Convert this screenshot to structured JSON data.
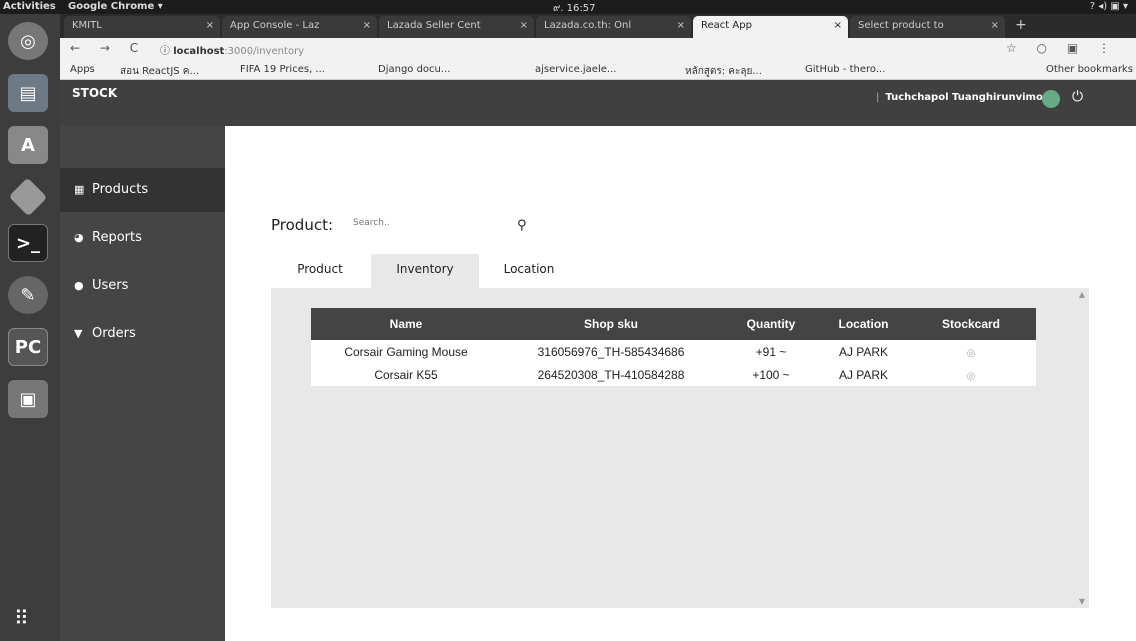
{
  "system": {
    "activities": "Activities",
    "app_name": "Google Chrome ▾",
    "clock": "๙. 16:57",
    "tray": "? ◂) ▣ ▾"
  },
  "browser": {
    "tabs": [
      {
        "label": "KMITL"
      },
      {
        "label": "App Console - Laz"
      },
      {
        "label": "Lazada Seller Cent"
      },
      {
        "label": "Lazada.co.th: Onl"
      },
      {
        "label": "React App"
      },
      {
        "label": "Select product to"
      }
    ],
    "active_tab": 4,
    "url_host": "localhost",
    "url_path": ":3000/inventory",
    "bookmarks": [
      "Apps",
      "สอน ReactJS ค...",
      "FIFA 19 Prices, ...",
      "Django docu...",
      "ajservice.jaele...",
      "หลักสูตร: คะลุย...",
      "GitHub - thero...",
      "Other bookmarks"
    ]
  },
  "app": {
    "brand": "STOCK",
    "user_name": "Tuchchapol Tuanghirunvimon",
    "sidebar": [
      {
        "label": "Products",
        "icon": "boxes-icon"
      },
      {
        "label": "Reports",
        "icon": "pie-chart-icon"
      },
      {
        "label": "Users",
        "icon": "user-icon"
      },
      {
        "label": "Orders",
        "icon": "cart-icon"
      }
    ],
    "active_sidebar": 0,
    "search": {
      "label": "Product:",
      "placeholder": "Search.."
    },
    "tabs": [
      "Product",
      "Inventory",
      "Location"
    ],
    "active_tab": 1,
    "table": {
      "headers": [
        "Name",
        "Shop sku",
        "Quantity",
        "Location",
        "Stockcard"
      ],
      "rows": [
        {
          "name": "Corsair Gaming Mouse",
          "sku": "316056976_TH-585434686",
          "quantity": "+91 ~",
          "location": "AJ PARK"
        },
        {
          "name": "Corsair K55",
          "sku": "264520308_TH-410584288",
          "quantity": "+100 ~",
          "location": "AJ PARK"
        }
      ]
    }
  },
  "colors": {
    "header_bg": "#404040",
    "sidebar_bg": "#454545",
    "sidebar_active": "#333333",
    "panel_bg": "#e8e8e8",
    "table_header_bg": "#444444"
  }
}
